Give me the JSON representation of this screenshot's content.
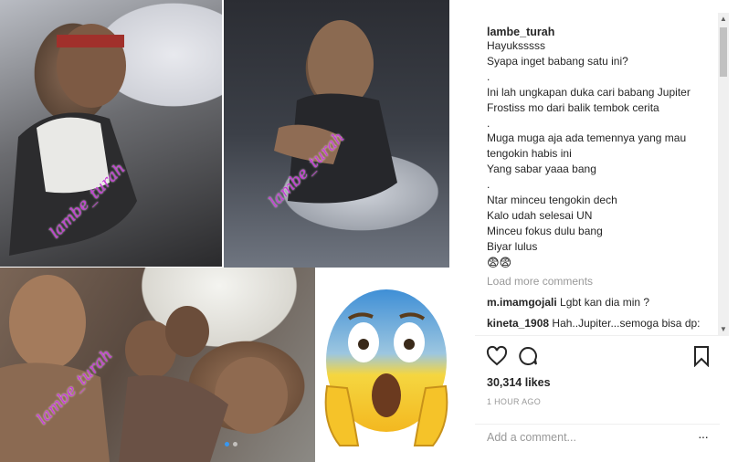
{
  "post": {
    "username": "lambe_turah",
    "caption_lines": [
      "Hayuksssss",
      "Syapa inget babang satu ini?",
      ".",
      "Ini lah ungkapan duka cari babang Jupiter",
      "Frostiss mo dari balik tembok cerita",
      ".",
      "Muga muga aja ada temennya yang mau",
      "tengokin habis ini",
      "Yang sabar yaaa bang",
      ".",
      "Ntar minceu tengokin dech",
      "Kalo udah selesai UN",
      "Minceu fokus dulu bang",
      "Biyar lulus"
    ],
    "caption_emojis": "😨😨",
    "load_more": "Load more comments",
    "comments": [
      {
        "user": "m.imamgojali",
        "text": "Lgbt kan dia min ?"
      },
      {
        "user": "kineta_1908",
        "text": "Hah..Jupiter...semoga bisa dp:"
      }
    ],
    "likes": "30,314",
    "likes_label": "likes",
    "time": "1 HOUR AGO",
    "add_comment_placeholder": "Add a comment...",
    "more_label": "···"
  },
  "media": {
    "watermark": "lambe_turah",
    "carousel_count": 2,
    "carousel_active": 1
  },
  "icons": {
    "like": "heart-icon",
    "comment": "comment-bubble-icon",
    "save": "bookmark-icon",
    "more": "more-options-icon",
    "scroll_up": "scroll-up-arrow-icon",
    "scroll_down": "scroll-down-arrow-icon"
  },
  "colors": {
    "accent": "#3897f0",
    "watermark": "#c63bd6",
    "muted": "#999999"
  }
}
